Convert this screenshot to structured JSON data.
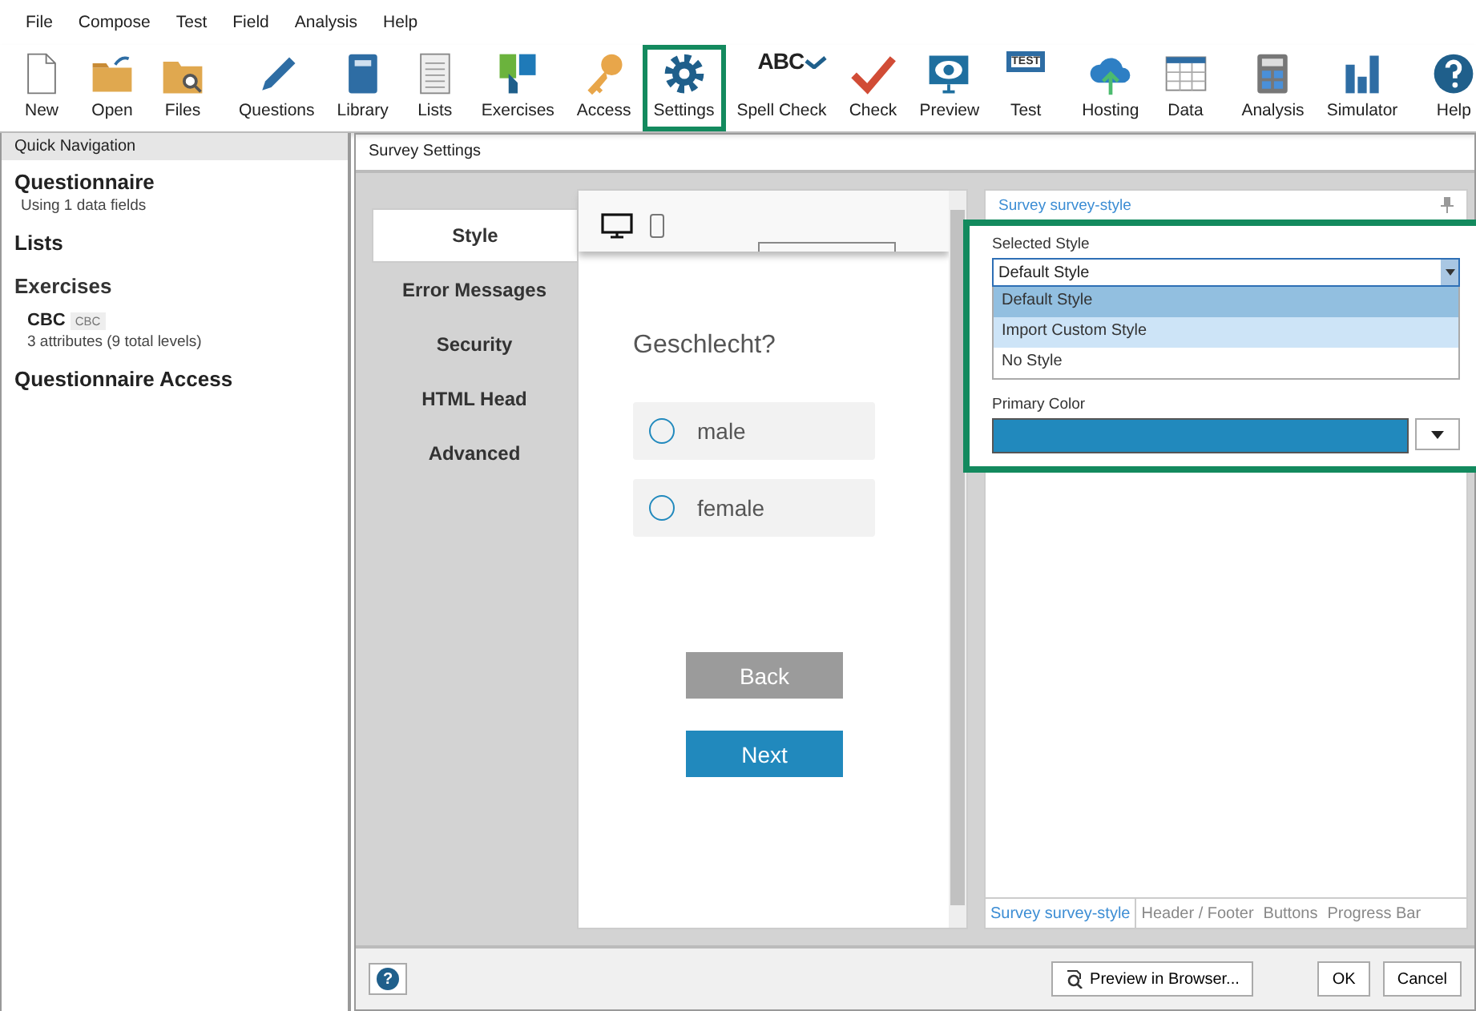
{
  "menu": [
    "File",
    "Compose",
    "Test",
    "Field",
    "Analysis",
    "Help"
  ],
  "toolbar": {
    "groups": [
      [
        {
          "label": "New",
          "selected": false
        },
        {
          "label": "Open",
          "selected": false
        },
        {
          "label": "Files",
          "selected": false
        }
      ],
      [
        {
          "label": "Questions",
          "selected": false
        },
        {
          "label": "Library",
          "selected": false
        },
        {
          "label": "Lists",
          "selected": false
        },
        {
          "label": "Exercises",
          "selected": false
        },
        {
          "label": "Access",
          "selected": false
        },
        {
          "label": "Settings",
          "selected": true
        },
        {
          "label": "Spell Check",
          "selected": false,
          "icon_text": "ABC"
        },
        {
          "label": "Check",
          "selected": false
        },
        {
          "label": "Preview",
          "selected": false
        },
        {
          "label": "Test",
          "selected": false,
          "icon_text": "TEST"
        }
      ],
      [
        {
          "label": "Hosting",
          "selected": false
        },
        {
          "label": "Data",
          "selected": false
        }
      ],
      [
        {
          "label": "Analysis",
          "selected": false
        },
        {
          "label": "Simulator",
          "selected": false
        }
      ],
      [
        {
          "label": "Help",
          "selected": false
        }
      ]
    ]
  },
  "quick_navigation": {
    "title": "Quick Navigation",
    "sections": [
      {
        "heading": "Questionnaire",
        "notes": [
          "Using 1 data fields"
        ]
      },
      {
        "heading": "Lists"
      },
      {
        "heading": "Exercises",
        "items": [
          {
            "name": "CBC",
            "tag": "CBC",
            "detail": "3 attributes (9 total levels)"
          }
        ]
      },
      {
        "heading": "Questionnaire Access"
      }
    ]
  },
  "dialog": {
    "title": "Survey Settings",
    "tabs": [
      {
        "label": "Style",
        "selected": true
      },
      {
        "label": "Error Messages",
        "selected": false
      },
      {
        "label": "Security",
        "selected": false
      },
      {
        "label": "HTML Head",
        "selected": false
      },
      {
        "label": "Advanced",
        "selected": false
      }
    ],
    "preview": {
      "question": "Geschlecht?",
      "options": [
        {
          "label": "male",
          "checked": false
        },
        {
          "label": "female",
          "checked": false
        }
      ],
      "buttons": [
        {
          "label": "Back",
          "kind": "secondary"
        },
        {
          "label": "Next",
          "kind": "primary"
        }
      ]
    },
    "style_panel": {
      "header": "Survey survey-style",
      "selected_style_label": "Selected Style",
      "selected_style": "Default Style",
      "options": [
        {
          "label": "Default Style",
          "selected": true,
          "highlighted": false
        },
        {
          "label": "Import Custom Style",
          "selected": false,
          "highlighted": true
        },
        {
          "label": "No Style",
          "selected": false,
          "highlighted": false
        }
      ],
      "primary_color_label": "Primary Color",
      "tabs": [
        {
          "label": "Survey survey-style",
          "selected": true
        },
        {
          "label": "Header / Footer",
          "selected": false
        },
        {
          "label": "Buttons",
          "selected": false
        },
        {
          "label": "Progress Bar",
          "selected": false
        }
      ]
    },
    "footer": {
      "help": "?",
      "preview_button": "Preview in Browser...",
      "ok": "OK",
      "cancel": "Cancel"
    }
  }
}
